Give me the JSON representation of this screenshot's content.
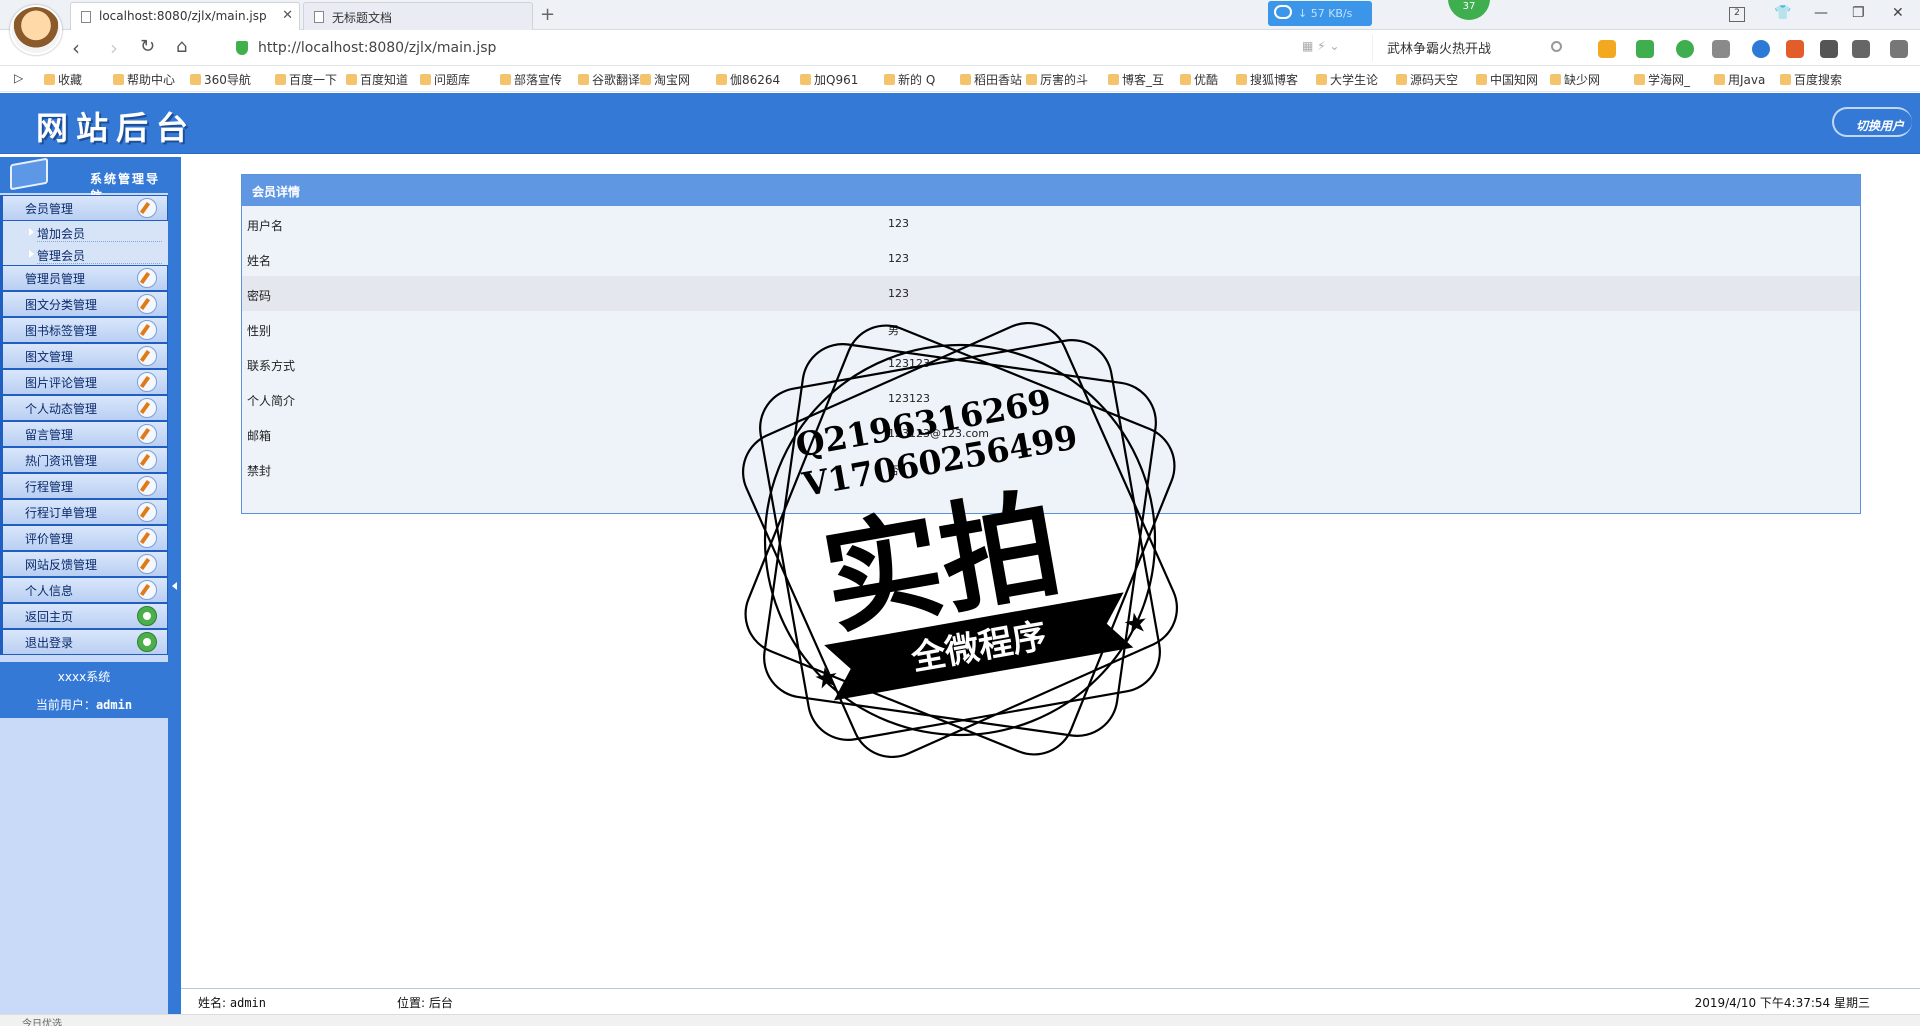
{
  "browser": {
    "tabs": [
      {
        "title": "localhost:8080/zjlx/main.jsp",
        "active": true
      },
      {
        "title": "无标题文档",
        "active": false
      }
    ],
    "new_tab": "+",
    "net_speed": "↓ 57 KB/s",
    "notification_count": "37",
    "window_count": "2",
    "url": "http://localhost:8080/zjlx/main.jsp",
    "search_value": "武林争霸火热开战",
    "bookmarks": [
      "收藏",
      "帮助中心",
      "360导航",
      "百度一下",
      "百度知道",
      "问题库",
      "部落宣传",
      "谷歌翻译",
      "淘宝网",
      "伽86264",
      "加Q961",
      "新的 Q",
      "稻田香站",
      "厉害的斗",
      "博客_互",
      "优酷",
      "搜狐博客",
      "大学生论",
      "源码天空",
      "中国知网",
      "缺少网",
      "学海网_",
      "用Java",
      "百度搜索"
    ],
    "status_text": "今日优选"
  },
  "header": {
    "site_title": "网站后台",
    "switch_user": "切换用户"
  },
  "sidebar": {
    "title": "系统管理导航",
    "menu": [
      {
        "label": "会员管理",
        "icon": "edit-icon",
        "children": [
          "增加会员",
          "管理会员"
        ]
      },
      {
        "label": "管理员管理",
        "icon": "edit-icon"
      },
      {
        "label": "图文分类管理",
        "icon": "edit-icon"
      },
      {
        "label": "图书标签管理",
        "icon": "edit-icon"
      },
      {
        "label": "图文管理",
        "icon": "edit-icon"
      },
      {
        "label": "图片评论管理",
        "icon": "edit-icon"
      },
      {
        "label": "个人动态管理",
        "icon": "edit-icon"
      },
      {
        "label": "留言管理",
        "icon": "edit-icon"
      },
      {
        "label": "热门资讯管理",
        "icon": "edit-icon"
      },
      {
        "label": "行程管理",
        "icon": "edit-icon"
      },
      {
        "label": "行程订单管理",
        "icon": "edit-icon"
      },
      {
        "label": "评价管理",
        "icon": "edit-icon"
      },
      {
        "label": "网站反馈管理",
        "icon": "edit-icon"
      },
      {
        "label": "个人信息",
        "icon": "edit-icon"
      },
      {
        "label": "返回主页",
        "icon": "home-arrow-icon"
      },
      {
        "label": "退出登录",
        "icon": "exit-icon"
      }
    ],
    "system_name": "xxxx系统",
    "current_user_label": "当前用户：",
    "current_user": "admin"
  },
  "detail": {
    "title": "会员详情",
    "rows": [
      {
        "label": "用户名",
        "value": "123"
      },
      {
        "label": "姓名",
        "value": "123"
      },
      {
        "label": "密码",
        "value": "123"
      },
      {
        "label": "性别",
        "value": "男"
      },
      {
        "label": "联系方式",
        "value": "123123"
      },
      {
        "label": "个人简介",
        "value": "123123"
      },
      {
        "label": "邮箱",
        "value": "123123@123.com"
      },
      {
        "label": "禁封",
        "value": "否"
      }
    ]
  },
  "watermark": {
    "line1": "Q2196316269",
    "line2": "V17060256499",
    "main": "实拍",
    "ribbon": "全微程序"
  },
  "footer": {
    "name_label": "姓名:",
    "name_value": "admin",
    "location_label": "位置:",
    "location_value": "后台",
    "datetime": "2019/4/10 下午4:37:54 星期三"
  },
  "colors": {
    "brand_blue": "#3579d6",
    "table_header": "#5f97e3",
    "sidebar_bg": "#c8daf7"
  }
}
